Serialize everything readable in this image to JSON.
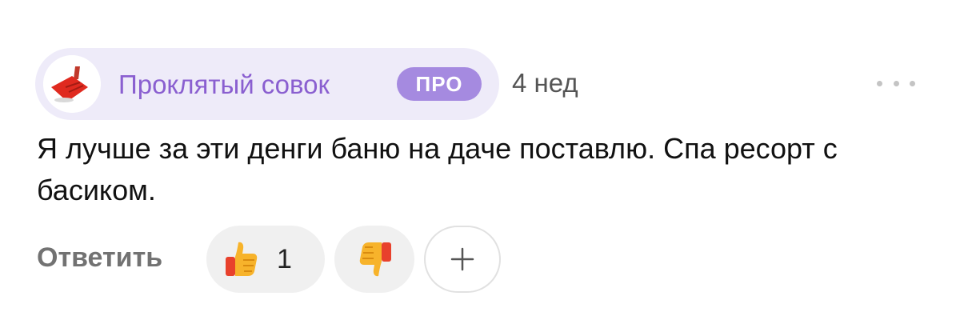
{
  "comment": {
    "author": {
      "name": "Проклятый совок",
      "badge": "ПРО",
      "avatar_icon": "red-dustpan-icon"
    },
    "timestamp": "4 нед",
    "text": "Я лучше за эти денги баню на даче поставлю. Спа ресорт с басиком.",
    "actions": {
      "reply_label": "Ответить",
      "reactions": [
        {
          "icon": "thumbs-up-emoji",
          "count": "1"
        },
        {
          "icon": "thumbs-down-emoji"
        }
      ],
      "add_reaction_icon": "plus-icon",
      "more_icon": "more-dots-icon"
    }
  },
  "colors": {
    "pill_background": "#eeebf9",
    "author_name": "#8a5fd0",
    "badge_background": "#a58ae0",
    "reaction_background": "#f0f0f0"
  }
}
